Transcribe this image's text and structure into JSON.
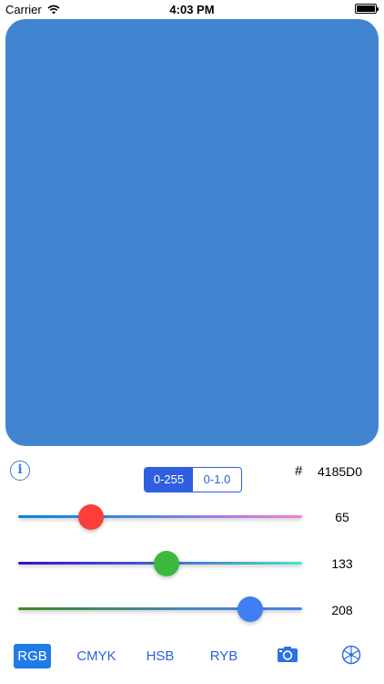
{
  "status_bar": {
    "carrier": "Carrier",
    "time": "4:03 PM"
  },
  "color": {
    "hex": "4185D0",
    "swatch_color": "#4185D0"
  },
  "hex": {
    "hash": "#",
    "value": "4185D0"
  },
  "info_icon": {
    "glyph": "i"
  },
  "range": {
    "options": [
      "0-255",
      "0-1.0"
    ],
    "selected": "0-255"
  },
  "sliders": [
    {
      "name": "red",
      "value": "65",
      "fraction": 0.255,
      "thumb_color": "#fc3d39"
    },
    {
      "name": "green",
      "value": "133",
      "fraction": 0.522,
      "thumb_color": "#3cb93c"
    },
    {
      "name": "blue",
      "value": "208",
      "fraction": 0.816,
      "thumb_color": "#3f7ff2"
    }
  ],
  "tabs": [
    {
      "label": "RGB",
      "selected": true
    },
    {
      "label": "CMYK",
      "selected": false
    },
    {
      "label": "HSB",
      "selected": false
    },
    {
      "label": "RYB",
      "selected": false
    }
  ],
  "icons": {
    "camera": "camera-icon",
    "color_wheel": "color-wheel-icon",
    "wifi": "wifi-icon",
    "battery": "battery-icon",
    "info": "info-icon"
  },
  "accent": "#2f5fe0"
}
